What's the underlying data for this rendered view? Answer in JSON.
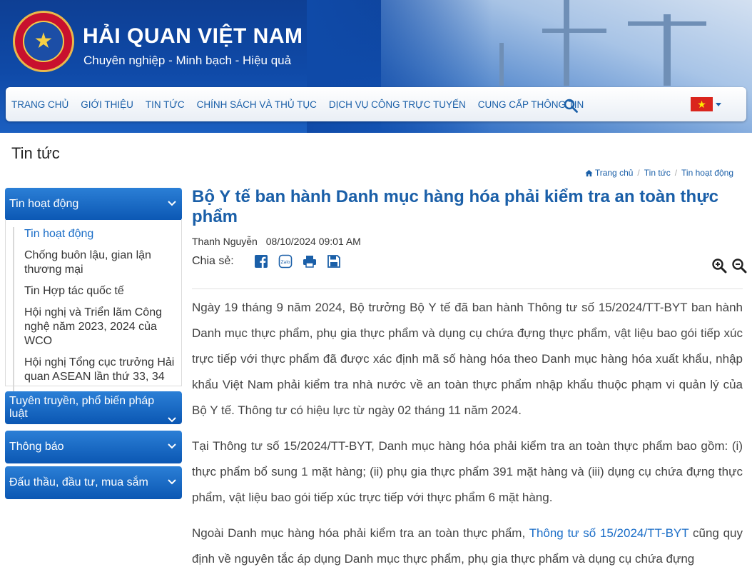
{
  "site": {
    "title": "HẢI QUAN VIỆT NAM",
    "slogan": "Chuyên nghiệp - Minh bạch - Hiệu quả"
  },
  "nav": {
    "items": [
      "TRANG CHỦ",
      "GIỚI THIỆU",
      "TIN TỨC",
      "CHÍNH SÁCH VÀ THỦ TỤC",
      "DỊCH VỤ CÔNG TRỰC TUYẾN",
      "CUNG CẤP THÔNG TIN"
    ],
    "language_flag": "vietnam-flag-icon",
    "flag_color": "#da251d"
  },
  "page": {
    "title": "Tin tức",
    "breadcrumb": [
      "Trang chủ",
      "Tin tức",
      "Tin hoạt động"
    ]
  },
  "sidebar": {
    "sections": [
      {
        "label": "Tin hoạt động",
        "expanded": true
      },
      {
        "label": "Tuyên truyền, phổ biến pháp luật",
        "expanded": false
      },
      {
        "label": "Thông báo",
        "expanded": false
      },
      {
        "label": "Đấu thầu, đầu tư, mua sắm",
        "expanded": false
      }
    ],
    "items": [
      "Tin hoạt động",
      "Chống buôn lậu, gian lận thương mại",
      "Tin Hợp tác quốc tế",
      "Hội nghị và Triển lãm Công nghệ năm 2023, 2024 của WCO",
      "Hội nghị Tổng cục trưởng Hải quan ASEAN lần thứ 33, 34"
    ]
  },
  "article": {
    "title": "Bộ Y tế ban hành Danh mục hàng hóa phải kiểm tra an toàn thực phẩm",
    "author": "Thanh Nguyễn",
    "datetime": "08/10/2024 09:01 AM",
    "share_label": "Chia sẻ:",
    "paragraphs": [
      "Ngày 19 tháng 9 năm 2024, Bộ trưởng Bộ Y tế đã ban hành Thông tư số 15/2024/TT-BYT ban hành Danh mục thực phẩm, phụ gia thực phẩm và dụng cụ chứa đựng thực phẩm, vật liệu bao gói tiếp xúc trực tiếp với thực phẩm đã được xác định mã số hàng hóa theo Danh mục hàng hóa xuất khẩu, nhập khẩu Việt Nam phải kiểm tra nhà nước về an toàn thực phẩm nhập khẩu thuộc phạm vi quản lý của Bộ Y tế. Thông tư có hiệu lực từ ngày 02 tháng 11 năm 2024.",
      "Tại Thông tư số 15/2024/TT-BYT, Danh mục hàng hóa phải kiểm tra an toàn thực phẩm bao gồm: (i) thực phẩm bổ sung 1 mặt hàng; (ii) phụ gia thực phẩm 391 mặt hàng và (iii) dụng cụ chứa đựng thực phẩm, vật liệu bao gói tiếp xúc trực tiếp với thực phẩm 6 mặt hàng."
    ],
    "p3_before": "Ngoài Danh mục hàng hóa phải kiểm tra an toàn thực phẩm, ",
    "p3_link": "Thông tư số 15/2024/TT-BYT",
    "p3_after": " cũng quy định về nguyên tắc áp dụng Danh mục thực phẩm, phụ gia thực phẩm và dụng cụ chứa đựng"
  },
  "colors": {
    "header_blue": "#0f4aa8",
    "link_blue": "#1a5fa8",
    "sidebar_blue": "#0b57b3"
  }
}
